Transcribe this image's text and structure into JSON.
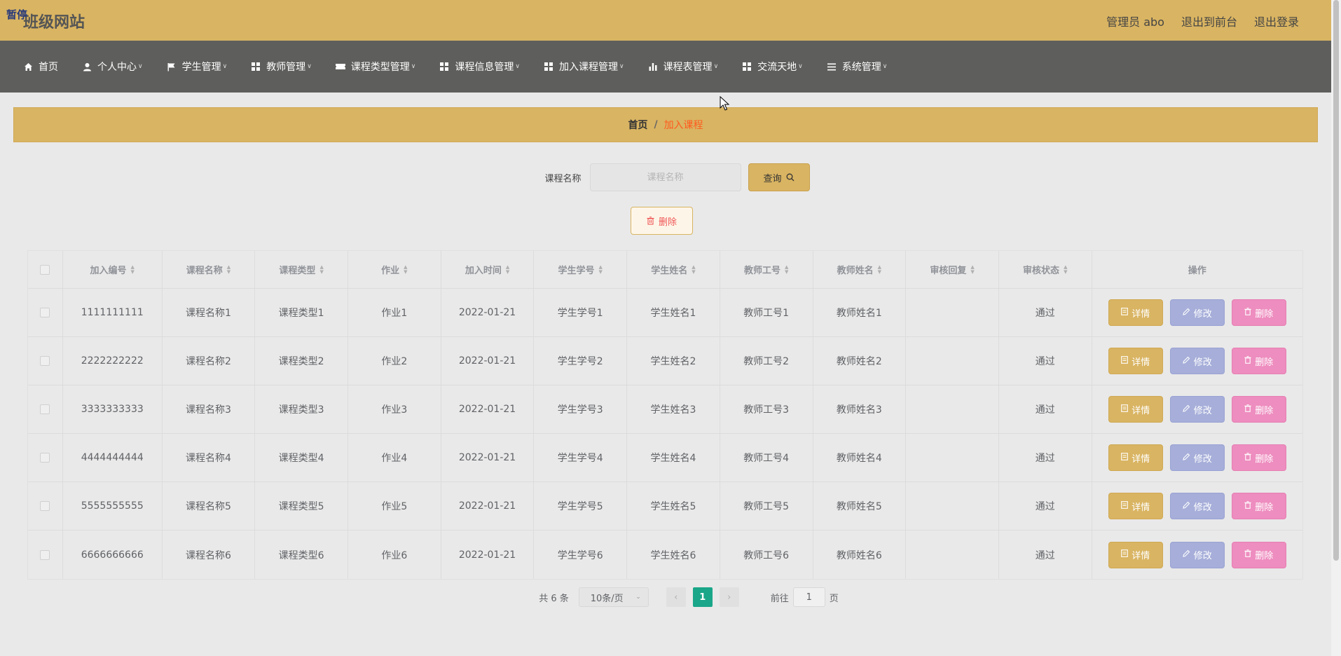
{
  "header": {
    "logo_tag": "暂停",
    "title": "班级网站",
    "links": [
      "管理员 abo",
      "退出到前台",
      "退出登录"
    ]
  },
  "nav": [
    {
      "label": "首页",
      "icon": "home-icon",
      "caret": false
    },
    {
      "label": "个人中心",
      "icon": "user-icon",
      "caret": true
    },
    {
      "label": "学生管理",
      "icon": "flag-icon",
      "caret": true
    },
    {
      "label": "教师管理",
      "icon": "grid-icon",
      "caret": true
    },
    {
      "label": "课程类型管理",
      "icon": "ticket-icon",
      "caret": true
    },
    {
      "label": "课程信息管理",
      "icon": "grid-icon",
      "caret": true
    },
    {
      "label": "加入课程管理",
      "icon": "grid-icon",
      "caret": true
    },
    {
      "label": "课程表管理",
      "icon": "bar-chart-icon",
      "caret": true
    },
    {
      "label": "交流天地",
      "icon": "grid-icon",
      "caret": true
    },
    {
      "label": "系统管理",
      "icon": "menu-icon",
      "caret": true
    }
  ],
  "breadcrumb": {
    "home": "首页",
    "sep": "/",
    "current": "加入课程"
  },
  "search": {
    "label": "课程名称",
    "placeholder": "课程名称",
    "value": "",
    "button": "查询"
  },
  "delete_button": "删除",
  "table": {
    "headers": [
      "加入编号",
      "课程名称",
      "课程类型",
      "作业",
      "加入时间",
      "学生学号",
      "学生姓名",
      "教师工号",
      "教师姓名",
      "审核回复",
      "审核状态",
      "操作"
    ],
    "rows": [
      [
        "1111111111",
        "课程名称1",
        "课程类型1",
        "作业1",
        "2022-01-21",
        "学生学号1",
        "学生姓名1",
        "教师工号1",
        "教师姓名1",
        "",
        "通过"
      ],
      [
        "2222222222",
        "课程名称2",
        "课程类型2",
        "作业2",
        "2022-01-21",
        "学生学号2",
        "学生姓名2",
        "教师工号2",
        "教师姓名2",
        "",
        "通过"
      ],
      [
        "3333333333",
        "课程名称3",
        "课程类型3",
        "作业3",
        "2022-01-21",
        "学生学号3",
        "学生姓名3",
        "教师工号3",
        "教师姓名3",
        "",
        "通过"
      ],
      [
        "4444444444",
        "课程名称4",
        "课程类型4",
        "作业4",
        "2022-01-21",
        "学生学号4",
        "学生姓名4",
        "教师工号4",
        "教师姓名4",
        "",
        "通过"
      ],
      [
        "5555555555",
        "课程名称5",
        "课程类型5",
        "作业5",
        "2022-01-21",
        "学生学号5",
        "学生姓名5",
        "教师工号5",
        "教师姓名5",
        "",
        "通过"
      ],
      [
        "6666666666",
        "课程名称6",
        "课程类型6",
        "作业6",
        "2022-01-21",
        "学生学号6",
        "学生姓名6",
        "教师工号6",
        "教师姓名6",
        "",
        "通过"
      ]
    ],
    "actions": {
      "detail": "详情",
      "edit": "修改",
      "delete": "删除"
    }
  },
  "pagination": {
    "total": "共 6 条",
    "page_size": "10条/页",
    "current_page": "1",
    "goto_prefix": "前往",
    "goto_value": "1",
    "goto_suffix": "页"
  },
  "colors": {
    "accent": "#d9b462",
    "nav_bg": "#5e5e5c",
    "breadcrumb_current": "#ff5a1f",
    "page_active": "#1aa689",
    "edit_btn": "#a6aed9",
    "delete_btn": "#ee8dbf"
  }
}
